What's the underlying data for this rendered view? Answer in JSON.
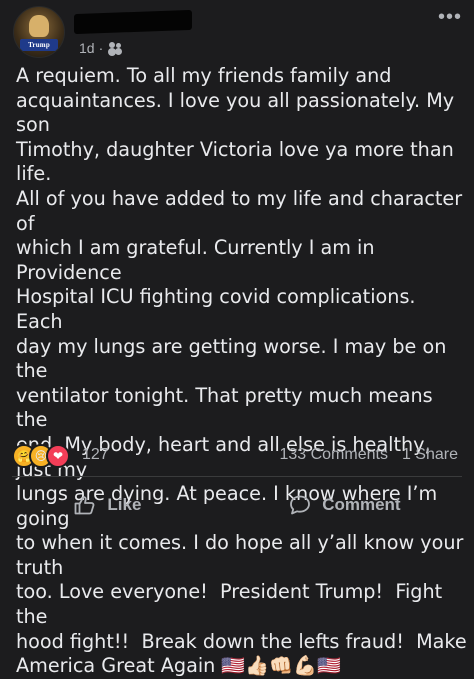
{
  "post": {
    "avatar_text": "Trump",
    "timestamp": "1d",
    "separator": "·",
    "audience_icon": "friends-icon",
    "more_icon": "more-options-icon",
    "more_label": "•••",
    "body": "A requiem. To all my friends family and\nacquaintances. I love you all passionately. My son\nTimothy, daughter Victoria love ya more than life.\nAll of you have added to my life and character of\nwhich I am grateful. Currently I am in Providence\nHospital ICU fighting covid complications. Each\nday my lungs are getting worse. I may be on the\nventilator tonight. That pretty much means the\nend. My body, heart and all else is healthy, just my\nlungs are dying. At peace. I know where I’m going\nto when it comes. I do hope all y’all know your truth\ntoo. Love everyone!  President Trump!  Fight the\nhood fight!!  Break down the lefts fraud!  Make\nAmerica Great Again 🇺🇸👍🏻👊🏻💪🏻🇺🇸"
  },
  "engagement": {
    "reaction_icons": [
      "care-reaction-icon",
      "sad-reaction-icon",
      "love-reaction-icon"
    ],
    "reaction_glyphs": [
      "🤗",
      "😢",
      "❤"
    ],
    "reaction_count": "127",
    "comments": "133 Comments",
    "shares": "1 Share"
  },
  "actions": {
    "like_label": "Like",
    "comment_label": "Comment"
  },
  "colors": {
    "background": "#1c1c1e",
    "text": "#e9eaed",
    "secondary_text": "#b0b3b8",
    "love": "#f33e58",
    "reaction_yellow": "#f7b125"
  }
}
